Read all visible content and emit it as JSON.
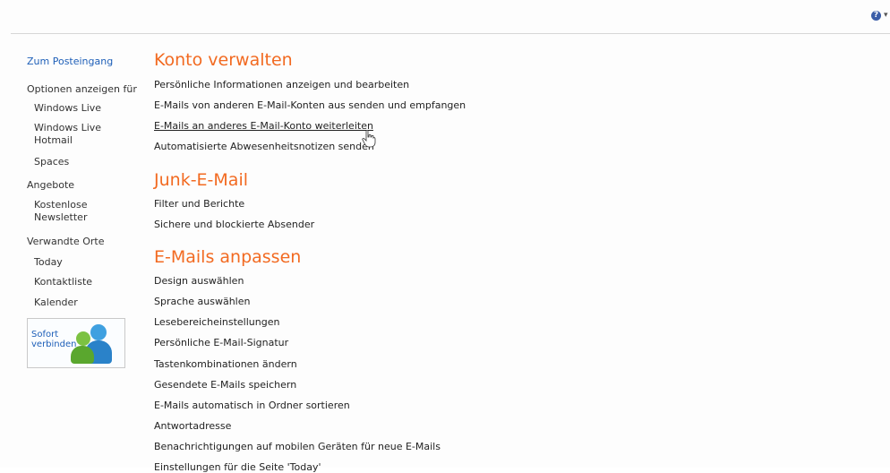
{
  "header": {
    "help_icon_glyph": "?",
    "dropdown_glyph": "▾"
  },
  "sidebar": {
    "inbox_link": "Zum Posteingang",
    "groups": [
      {
        "heading": "Optionen anzeigen für",
        "items": [
          "Windows Live",
          "Windows Live Hotmail",
          "Spaces"
        ]
      },
      {
        "heading": "Angebote",
        "items": [
          "Kostenlose Newsletter"
        ]
      },
      {
        "heading": "Verwandte Orte",
        "items": [
          "Today",
          "Kontaktliste",
          "Kalender"
        ]
      }
    ],
    "promo": {
      "label": "Sofort verbinden",
      "icon": "messenger-buddies-icon"
    }
  },
  "main": {
    "sections": [
      {
        "title": "Konto verwalten",
        "items": [
          "Persönliche Informationen anzeigen und bearbeiten",
          "E-Mails von anderen E-Mail-Konten aus senden und empfangen",
          "E-Mails an anderes E-Mail-Konto weiterleiten",
          "Automatisierte Abwesenheitsnotizen senden"
        ]
      },
      {
        "title": "Junk-E-Mail",
        "items": [
          "Filter und Berichte",
          "Sichere und blockierte Absender"
        ]
      },
      {
        "title": "E-Mails anpassen",
        "items": [
          "Design auswählen",
          "Sprache auswählen",
          "Lesebereicheinstellungen",
          "Persönliche E-Mail-Signatur",
          "Tastenkombinationen ändern",
          "Gesendete E-Mails speichern",
          "E-Mails automatisch in Ordner sortieren",
          "Antwortadresse",
          "Benachrichtigungen auf mobilen Geräten für neue E-Mails",
          "Einstellungen für die Seite 'Today'"
        ]
      }
    ]
  },
  "colors": {
    "section_title": "#f26a21",
    "link": "#1e5fb8"
  }
}
